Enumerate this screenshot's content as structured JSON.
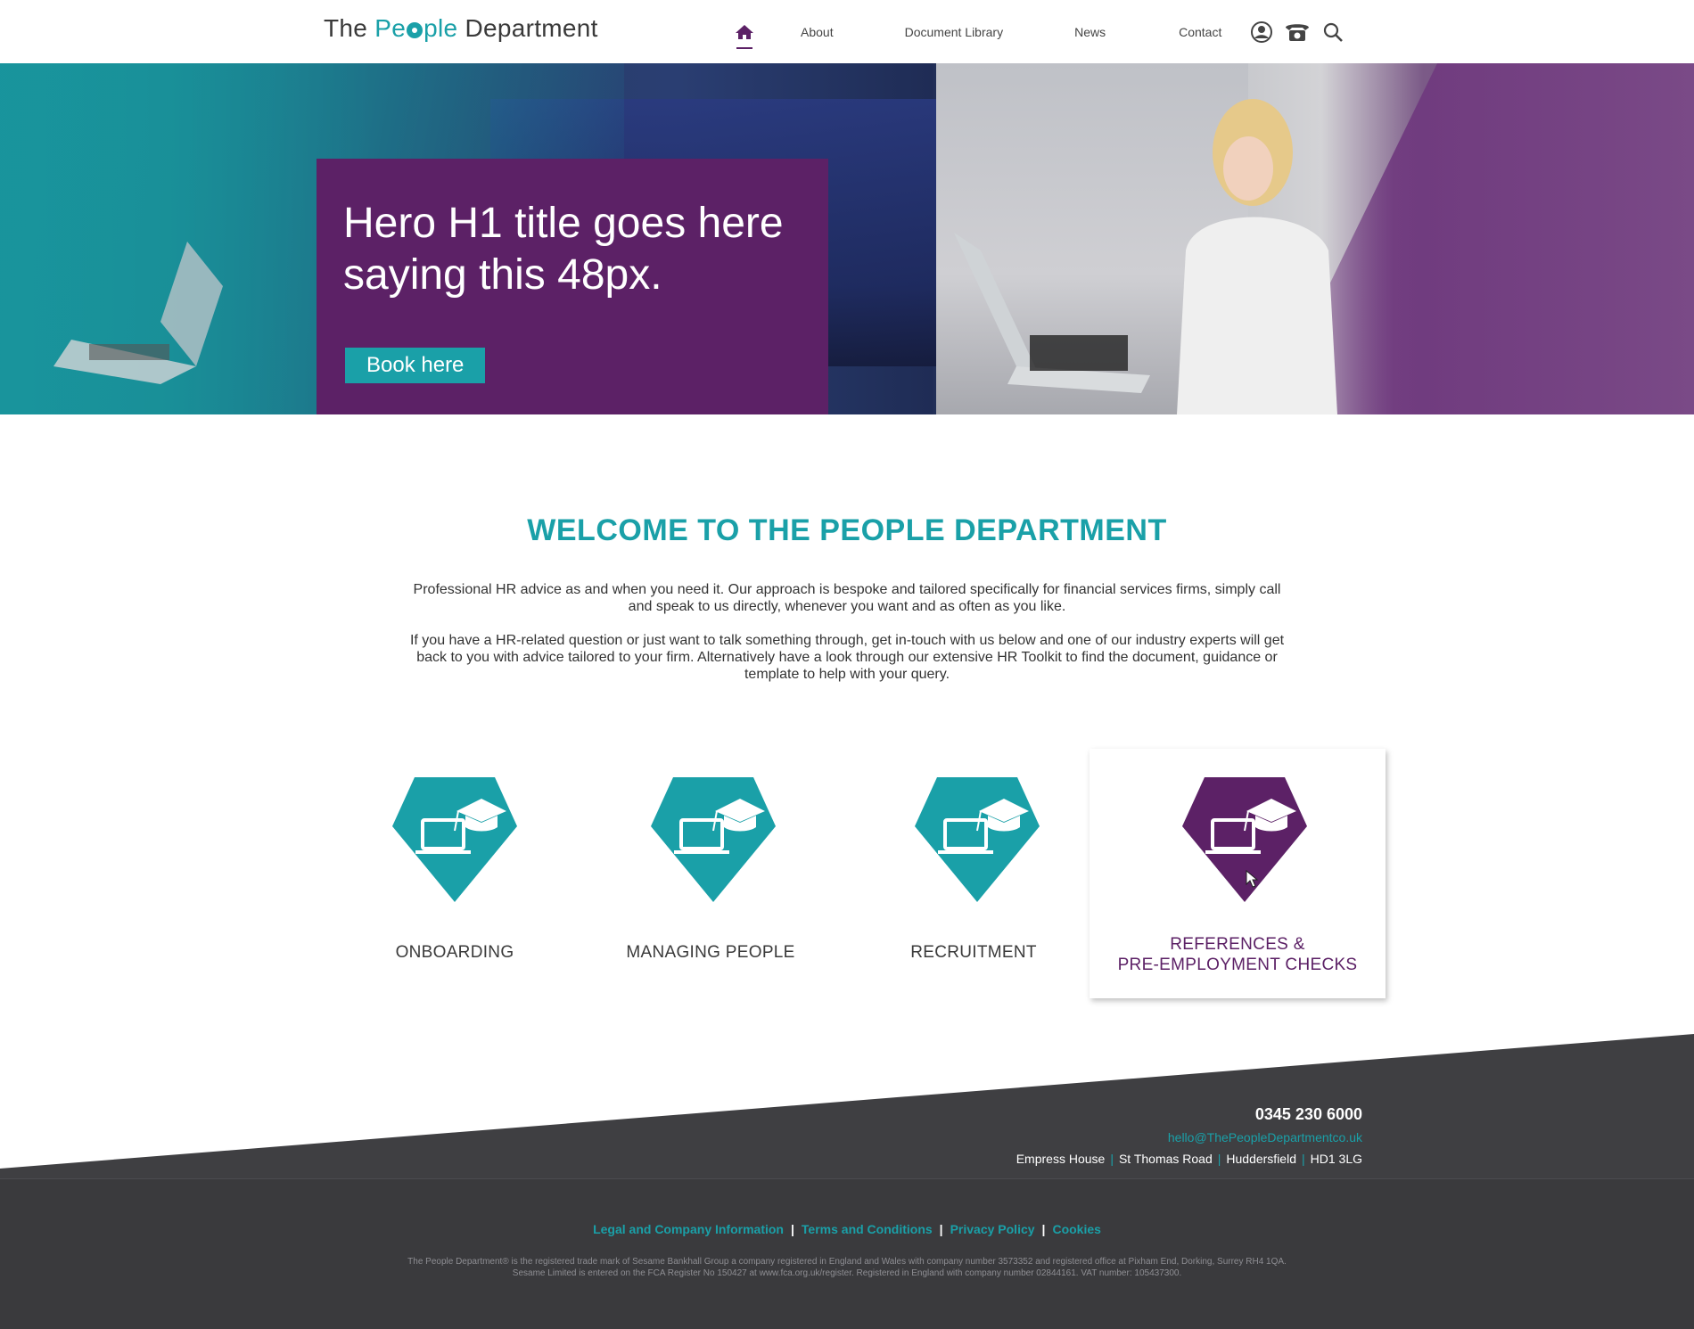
{
  "header": {
    "logo": {
      "part1": "The",
      "part2a": "Pe",
      "part2b": "ple",
      "part3": "Department"
    },
    "nav": {
      "home_icon": "home-icon",
      "items": [
        "About",
        "Document Library",
        "News",
        "Contact"
      ],
      "icons": [
        "user-icon",
        "phone-icon",
        "search-icon"
      ]
    }
  },
  "hero": {
    "title": "Hero H1 title goes here saying this 48px.",
    "button_label": "Book here"
  },
  "welcome": {
    "title": "WELCOME TO THE PEOPLE DEPARTMENT",
    "paragraph1": "Professional HR advice as and when you need it. Our approach is bespoke and tailored specifically for financial services firms, simply call and speak to us directly, whenever you want and as often as you like.",
    "paragraph2": "If you have a HR-related question or just want to talk something through, get in-touch with us below and one of our industry experts will get back to you with advice tailored to your firm. Alternatively have a look through our extensive HR Toolkit to find the document, guidance or template to help with your query."
  },
  "services": [
    {
      "label": "ONBOARDING",
      "color": "#1aa0a8",
      "icon": "laptop-graduation-icon"
    },
    {
      "label": "MANAGING PEOPLE",
      "color": "#1aa0a8",
      "icon": "laptop-graduation-icon"
    },
    {
      "label": "RECRUITMENT",
      "color": "#1aa0a8",
      "icon": "laptop-graduation-icon"
    },
    {
      "label_line1": "REFERENCES &",
      "label_line2": "PRE-EMPLOYMENT CHECKS",
      "color": "#5c2166",
      "icon": "laptop-graduation-icon"
    }
  ],
  "footer": {
    "phone": "0345 230 6000",
    "email": "hello@ThePeopleDepartmentco.uk",
    "address": [
      "Empress House",
      "St Thomas Road",
      "Huddersfield",
      "HD1 3LG"
    ],
    "links": [
      "Legal and Company Information",
      "Terms and Conditions",
      "Privacy Policy",
      "Cookies"
    ],
    "fine_print_line1": "The People Department® is the registered trade mark of Sesame Bankhall Group a company registered in England and Wales with company number 3573352 and registered office at Pixham End, Dorking, Surrey RH4 1QA.",
    "fine_print_line2": "Sesame Limited is entered on the FCA Register No 150427 at www.fca.org.uk/register. Registered in England with company number 02844161. VAT number: 105437300."
  },
  "colors": {
    "teal": "#1aa0a8",
    "purple": "#5c2166",
    "footer_bg": "#3f3f42"
  }
}
